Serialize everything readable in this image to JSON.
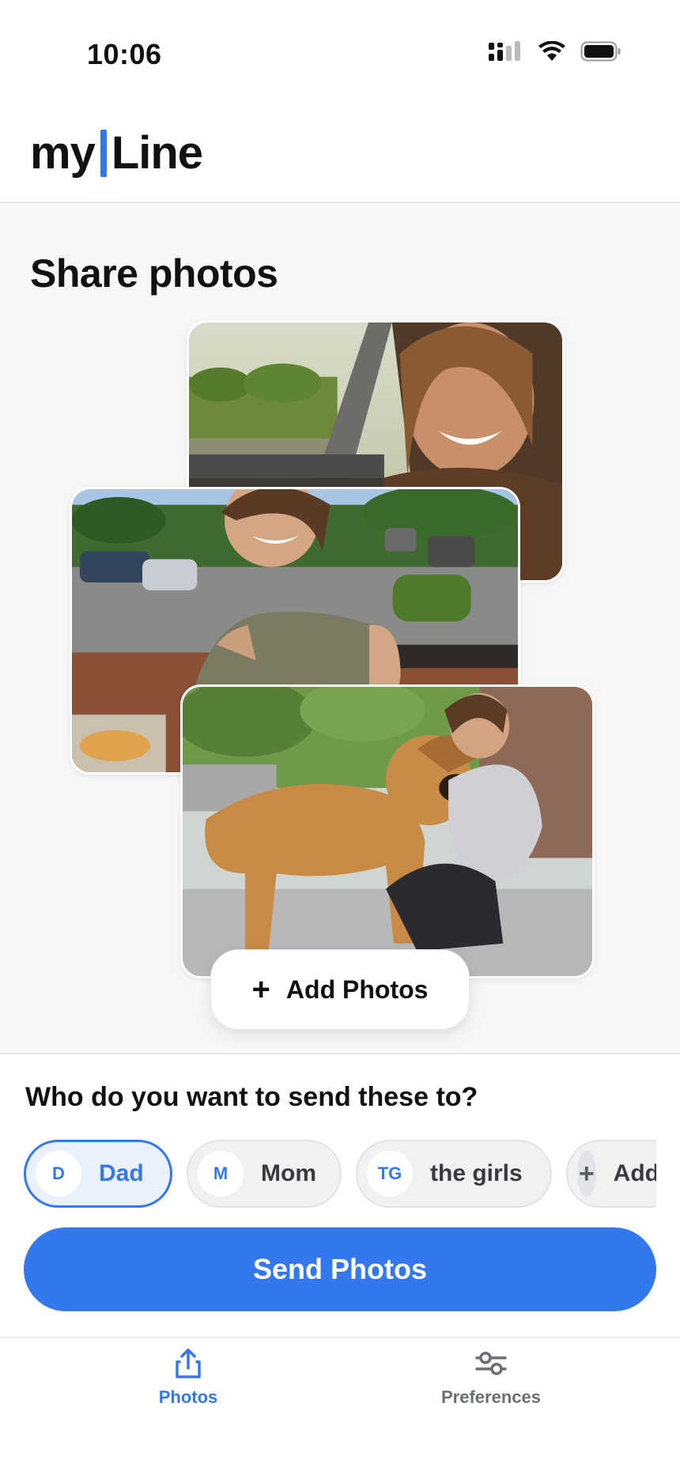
{
  "status_bar": {
    "time": "10:06",
    "icons": [
      "cellular-signal-icon",
      "wifi-icon",
      "battery-icon"
    ]
  },
  "header": {
    "logo_left": "my",
    "logo_right": "Line",
    "accent_color": "#3478f0"
  },
  "main": {
    "title": "Share photos",
    "photos": [
      {
        "name": "woman-in-car-photo"
      },
      {
        "name": "woman-eating-photo"
      },
      {
        "name": "woman-with-dog-photo"
      }
    ],
    "add_photos_label": "Add Photos"
  },
  "recipients": {
    "title": "Who do you want to send these to?",
    "chips": [
      {
        "initials": "D",
        "label": "Dad",
        "selected": true
      },
      {
        "initials": "M",
        "label": "Mom",
        "selected": false
      },
      {
        "initials": "TG",
        "label": "the girls",
        "selected": false
      },
      {
        "initials": "+",
        "label": "Add",
        "selected": false
      }
    ],
    "send_label": "Send Photos"
  },
  "tab_bar": {
    "tabs": [
      {
        "label": "Photos",
        "icon": "share-upload-icon",
        "active": true
      },
      {
        "label": "Preferences",
        "icon": "sliders-icon",
        "active": false
      }
    ]
  }
}
